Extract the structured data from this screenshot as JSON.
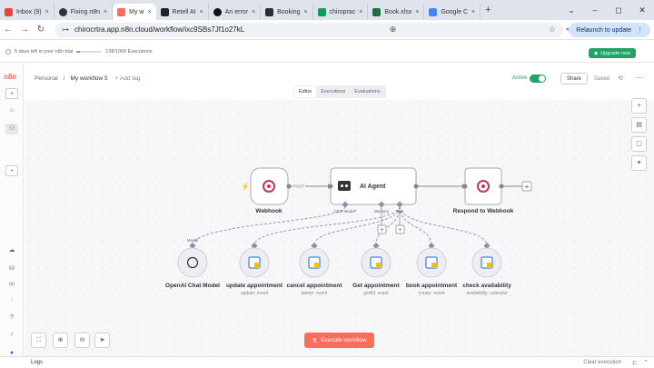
{
  "browser": {
    "tabs": [
      {
        "label": "Inbox (9)",
        "color": "#ea4335"
      },
      {
        "label": "Fixing n8n",
        "color": "#333333"
      },
      {
        "label": "My w",
        "color": "#ff6d5a",
        "active": true
      },
      {
        "label": "Retell AI",
        "color": "#222222"
      },
      {
        "label": "An error",
        "color": "#111111"
      },
      {
        "label": "Booking",
        "color": "#2d2d2d"
      },
      {
        "label": "chiroprac",
        "color": "#0f9d58"
      },
      {
        "label": "Book.xlsx",
        "color": "#1d6f42"
      },
      {
        "label": "Google C",
        "color": "#4285f4"
      }
    ],
    "close_glyph": "×",
    "new_tab": "+",
    "window_controls": {
      "chevron": "⌄",
      "minimize": "–",
      "maximize": "◻",
      "close": "✕"
    },
    "url": "chirocrtra.app.n8n.cloud/workflow/ixc9SBs7Jf1o27kL",
    "relaunch_label": "Relaunch to update",
    "nav": {
      "back": "←",
      "forward": "→",
      "reload": "↻",
      "tune": "⊶",
      "zoom": "⊕",
      "star": "☆",
      "account": "⊶",
      "menu": "⋮"
    }
  },
  "trial": {
    "days_left": "5 days left in your n8n trial",
    "executions": "138/1000 Executions",
    "progress": 0.138,
    "upgrade_label": "Upgrade now"
  },
  "sidebar": {
    "logo": "n8n",
    "icons": {
      "add": "+",
      "home": "⌂",
      "person": "⚇",
      "plus2": "+",
      "cloud": "☁",
      "database": "⛁",
      "variables": "(x)",
      "insights": "⫶",
      "help": "?",
      "notifications": "♪",
      "avatar": "●"
    }
  },
  "header": {
    "workspace": "Personal",
    "separator": "/",
    "workflow_name": "My workflow 5",
    "add_tag": "+ Add tag",
    "active_label": "Active",
    "active": true,
    "share": "Share",
    "saved": "Saved",
    "history_icon": "⟲",
    "more": "⋯"
  },
  "mode_tabs": [
    "Editor",
    "Executions",
    "Evaluations"
  ],
  "canvas_nodes": {
    "webhook": {
      "label": "Webhook"
    },
    "agent": {
      "label": "AI Agent"
    },
    "respond": {
      "label": "Respond to Webhook"
    },
    "post_label": "POST",
    "agent_ports": [
      "Chat Model*",
      "Memory",
      "Tool"
    ],
    "model_port": "Model",
    "tools": [
      {
        "label": "OpenAI Chat Model",
        "sub": ""
      },
      {
        "label": "update appointment",
        "sub": "update: event"
      },
      {
        "label": "cancel appointment",
        "sub": "delete: event"
      },
      {
        "label": "Get appointment",
        "sub": "getAll: event"
      },
      {
        "label": "book appointment",
        "sub": "create: event"
      },
      {
        "label": "check availability",
        "sub": "availability: calendar"
      }
    ]
  },
  "right_tools": {
    "plus": "+",
    "doc": "▤",
    "panel": "▢",
    "sparkle": "✦"
  },
  "bottom_tools": {
    "fit": "⛶",
    "zoom_in": "⊕",
    "zoom_out": "⊖",
    "cursor": "➤"
  },
  "execute_label": "Execute workflow",
  "execute_icon": "⚗",
  "logs": {
    "label": "Logs",
    "clear": "Clear execution",
    "resize": "⊏",
    "collapse": "⌃"
  },
  "colors": {
    "accent": "#ff6d5a",
    "active": "#21a366",
    "connector": "#8a8fb0"
  }
}
